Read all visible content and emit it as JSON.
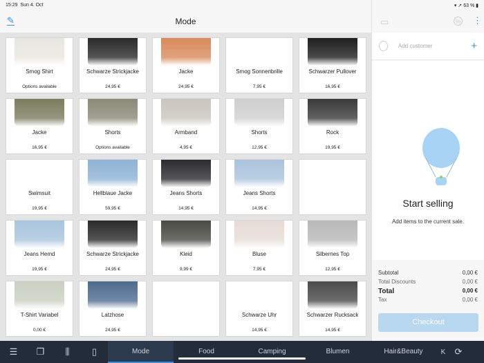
{
  "status": {
    "time": "15:29",
    "date": "Sun 4. Oct",
    "battery": "63 %"
  },
  "header": {
    "title": "Mode"
  },
  "products": [
    {
      "name": "Smog Shirt",
      "price": "Options available",
      "color": "#e8e6e0"
    },
    {
      "name": "Schwarze Strickjacke",
      "price": "24,95 €",
      "color": "#2a2a2a"
    },
    {
      "name": "Jacke",
      "price": "24,95 €",
      "color": "#d98a5a"
    },
    {
      "name": "Smog Sonnenbrille",
      "price": "7,95 €",
      "color": "#555"
    },
    {
      "name": "Schwarzer Pullover",
      "price": "16,95 €",
      "color": "#1e1e1e"
    },
    {
      "name": "Jacke",
      "price": "16,95 €",
      "color": "#7a7d5e"
    },
    {
      "name": "Shorts",
      "price": "Options available",
      "color": "#8a8a78"
    },
    {
      "name": "Armband",
      "price": "4,95 €",
      "color": "#c9c4bd"
    },
    {
      "name": "Shorts",
      "price": "12,95 €",
      "color": "#cfcfcf"
    },
    {
      "name": "Rock",
      "price": "19,95 €",
      "color": "#3a3a3a"
    },
    {
      "name": "Swimsuit",
      "price": "19,95 €",
      "color": "#222"
    },
    {
      "name": "Hellblaue Jacke",
      "price": "59,95 €",
      "color": "#8fb2d6"
    },
    {
      "name": "Jeans Shorts",
      "price": "14,95 €",
      "color": "#2b2b30"
    },
    {
      "name": "Jeans Shorts",
      "price": "14,95 €",
      "color": "#a9c3dc"
    },
    {
      "name": "",
      "price": "",
      "color": ""
    },
    {
      "name": "Jeans Hemd",
      "price": "19,95 €",
      "color": "#a8c4de"
    },
    {
      "name": "Schwarze Strickjacke",
      "price": "24,95 €",
      "color": "#2a2a2a"
    },
    {
      "name": "Kleid",
      "price": "9,99 €",
      "color": "#4a4a44"
    },
    {
      "name": "Bluse",
      "price": "7,95 €",
      "color": "#e6dcd6"
    },
    {
      "name": "Silbernes Top",
      "price": "12,95 €",
      "color": "#b8b8b8"
    },
    {
      "name": "T-Shirt Variabel",
      "price": "0,00 €",
      "color": "#c9d0c2"
    },
    {
      "name": "Latzhose",
      "price": "24,95 €",
      "color": "#4d6b8f"
    },
    {
      "name": "",
      "price": "",
      "color": ""
    },
    {
      "name": "Schwarze Uhr",
      "price": "14,95 €",
      "color": "#333"
    },
    {
      "name": "Schwarzer Rucksack",
      "price": "14,95 €",
      "color": "#4a4a4a"
    }
  ],
  "cart": {
    "add_customer": "Add customer",
    "start": "Start selling",
    "sub": "Add items to the current sale.",
    "subtotal_label": "Subtotal",
    "subtotal": "0,00 €",
    "discounts_label": "Total Discounts",
    "discounts": "0,00 €",
    "total_label": "Total",
    "total": "0,00 €",
    "tax_label": "Tax",
    "tax": "0,00 €",
    "checkout": "Checkout"
  },
  "tabs": [
    "Mode",
    "Food",
    "Camping",
    "Blumen",
    "Hair&Beauty",
    "K"
  ]
}
